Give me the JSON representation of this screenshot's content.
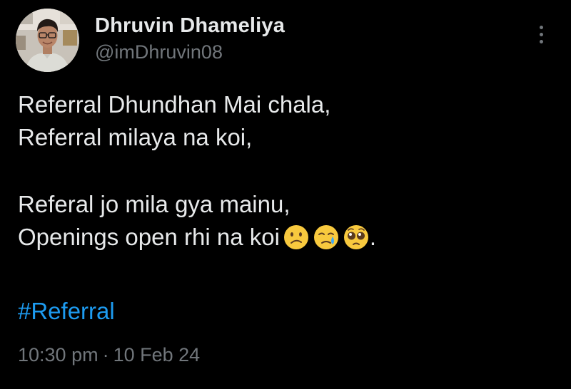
{
  "tweet": {
    "author": {
      "display_name": "Dhruvin Dhameliya",
      "handle": "@imDhruvin08",
      "avatar_icon": "profile-photo"
    },
    "more_icon": "vertical-ellipsis-icon",
    "lines": [
      "Referral Dhundhan Mai chala,",
      "Referral milaya na koi,",
      "",
      "Referal jo mila gya mainu,",
      "Openings open rhi na koi"
    ],
    "emojis": [
      "confused-face",
      "crying-face",
      "pleading-face"
    ],
    "trailing_punct": ".",
    "hashtag": "#Referral",
    "time": "10:30 pm",
    "separator": "·",
    "date": "10 Feb 24",
    "colors": {
      "background": "#000000",
      "text": "#e7e9ea",
      "secondary": "#71767b",
      "link": "#1d9bf0"
    }
  }
}
